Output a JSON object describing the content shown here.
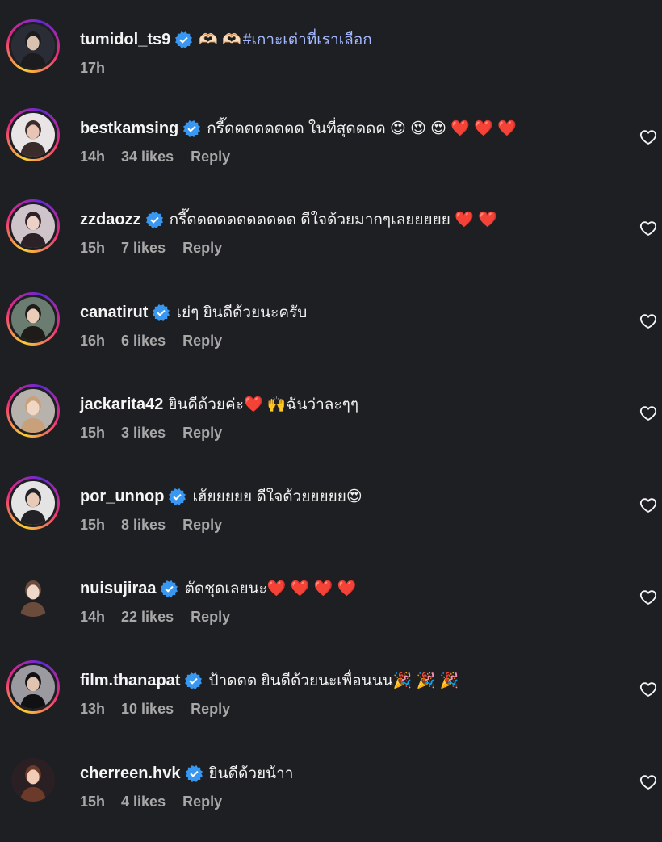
{
  "comments": [
    {
      "username": "tumidol_ts9",
      "verified": true,
      "text": "🫶🏻 🫶🏻",
      "hashtag": "#เกาะเต่าที่เราเลือก",
      "time": "17h",
      "likes": "",
      "reply": "",
      "has_like_button": false
    },
    {
      "username": "bestkamsing",
      "verified": true,
      "text": "กรี๊ดดดดดดดด ในที่สุดดดด 😍 😍 😍 ❤️ ❤️ ❤️",
      "hashtag": "",
      "time": "14h",
      "likes": "34 likes",
      "reply": "Reply",
      "has_like_button": true
    },
    {
      "username": "zzdaozz",
      "verified": true,
      "text": "กรี๊ดดดดดดดดดดด ดีใจด้วยมากๆเลยยยยย ❤️ ❤️",
      "hashtag": "",
      "time": "15h",
      "likes": "7 likes",
      "reply": "Reply",
      "has_like_button": true
    },
    {
      "username": "canatirut",
      "verified": true,
      "text": "เย่ๆ ยินดีด้วยนะครับ",
      "hashtag": "",
      "time": "16h",
      "likes": "6 likes",
      "reply": "Reply",
      "has_like_button": true
    },
    {
      "username": "jackarita42",
      "verified": false,
      "text": "ยินดีด้วยค่ะ❤️ 🙌ฉันว่าละๆๆ",
      "hashtag": "",
      "time": "15h",
      "likes": "3 likes",
      "reply": "Reply",
      "has_like_button": true
    },
    {
      "username": "por_unnop",
      "verified": true,
      "text": "เฮ้ยยยยย ดีใจด้วยยยยย😍",
      "hashtag": "",
      "time": "15h",
      "likes": "8 likes",
      "reply": "Reply",
      "has_like_button": true
    },
    {
      "username": "nuisujiraa",
      "verified": true,
      "text": "ตัดชุดเลยนะ❤️ ❤️ ❤️ ❤️",
      "hashtag": "",
      "time": "14h",
      "likes": "22 likes",
      "reply": "Reply",
      "has_like_button": true
    },
    {
      "username": "film.thanapat",
      "verified": true,
      "text": "ป้าดดด ยินดีด้วยนะเพื่อนนน🎉 🎉 🎉",
      "hashtag": "",
      "time": "13h",
      "likes": "10 likes",
      "reply": "Reply",
      "has_like_button": true
    },
    {
      "username": "cherreen.hvk",
      "verified": true,
      "text": "ยินดีด้วยน้าา",
      "hashtag": "",
      "time": "15h",
      "likes": "4 likes",
      "reply": "Reply",
      "has_like_button": true
    }
  ],
  "icons": {
    "verified": "verified-badge-icon",
    "like": "heart-outline-icon"
  },
  "colors": {
    "background": "#1e1f22",
    "verified": "#3897f0",
    "hashtag": "#a3b8ff",
    "meta": "#a8a8a8"
  }
}
